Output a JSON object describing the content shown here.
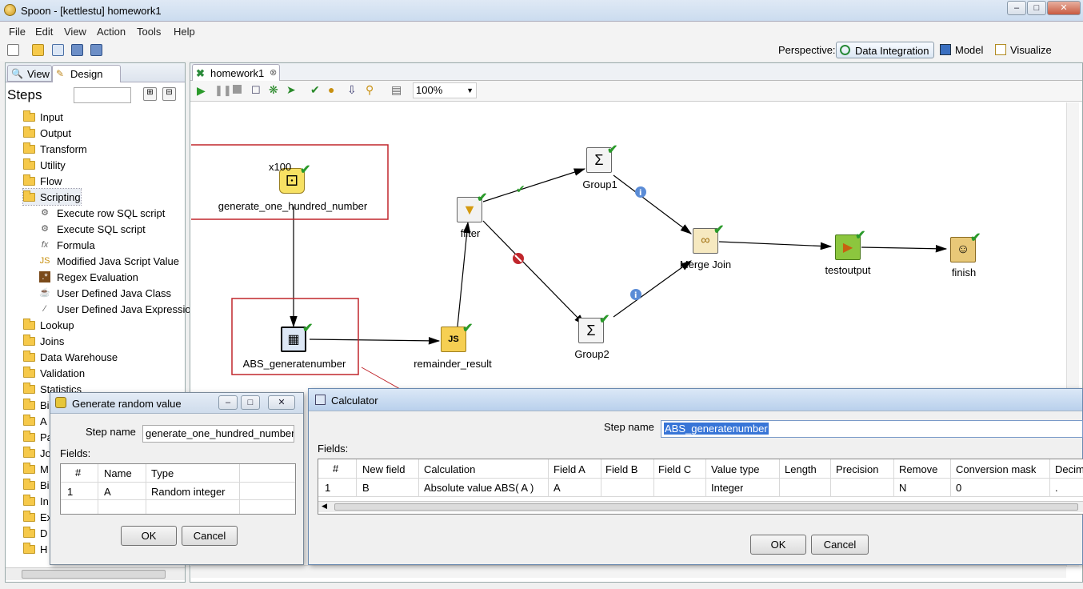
{
  "window": {
    "title": "Spoon - [kettlestu] homework1"
  },
  "menu": [
    "File",
    "Edit",
    "View",
    "Action",
    "Tools",
    "Help"
  ],
  "perspective": {
    "label": "Perspective:",
    "items": [
      "Data Integration",
      "Model",
      "Visualize"
    ]
  },
  "left_panel": {
    "tabs": [
      "View",
      "Design"
    ],
    "heading": "Steps",
    "search_placeholder": "",
    "folders_top": [
      "Input",
      "Output",
      "Transform",
      "Utility",
      "Flow",
      "Scripting"
    ],
    "scripting_items": [
      "Execute row SQL script",
      "Execute SQL script",
      "Formula",
      "Modified Java Script Value",
      "Regex Evaluation",
      "User Defined Java Class",
      "User Defined Java Expressio"
    ],
    "folders_bottom": [
      "Lookup",
      "Joins",
      "Data Warehouse",
      "Validation",
      "Statistics",
      "Bi",
      "A",
      "Pa",
      "Jo",
      "M",
      "Bi",
      "In",
      "Ex",
      "D",
      "H"
    ]
  },
  "editor": {
    "tab": "homework1",
    "zoom": "100%",
    "nodes": {
      "gen": "generate_one_hundred_number",
      "gen_copies": "x100",
      "abs": "ABS_generatenumber",
      "remainder": "remainder_result",
      "filter": "filter",
      "group1": "Group1",
      "group2": "Group2",
      "merge": "Merge Join",
      "testoutput": "testoutput",
      "finish": "finish"
    }
  },
  "dialog_random": {
    "title": "Generate random value",
    "step_name_label": "Step name",
    "step_name_value": "generate_one_hundred_number",
    "fields_label": "Fields:",
    "columns": [
      "#",
      "Name",
      "Type"
    ],
    "rows": [
      [
        "1",
        "A",
        "Random integer"
      ]
    ],
    "ok": "OK",
    "cancel": "Cancel"
  },
  "dialog_calc": {
    "title": "Calculator",
    "step_name_label": "Step name",
    "step_name_value": "ABS_generatenumber",
    "fields_label": "Fields:",
    "columns": [
      "#",
      "New field",
      "Calculation",
      "Field A",
      "Field B",
      "Field C",
      "Value type",
      "Length",
      "Precision",
      "Remove",
      "Conversion mask",
      "Decim"
    ],
    "rows": [
      [
        "1",
        "B",
        "Absolute value ABS( A )",
        "A",
        "",
        "",
        "Integer",
        "",
        "",
        "N",
        "0",
        "."
      ]
    ],
    "ok": "OK",
    "cancel": "Cancel"
  },
  "colors": {
    "highlight_box": "#c0262c",
    "hop_ok": "#2a9a2a",
    "selected_text_bg": "#3875d7"
  }
}
